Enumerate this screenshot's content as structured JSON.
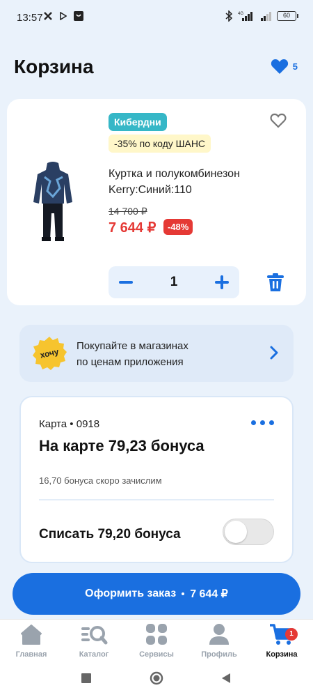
{
  "status_bar": {
    "time": "13:57",
    "battery": "60",
    "network": "4G"
  },
  "header": {
    "title": "Корзина",
    "favorites_count": "5"
  },
  "product": {
    "promo_tag": "Кибердни",
    "promo_code": "-35% по коду ШАНС",
    "name_line1": "Куртка и полукомбинезон",
    "name_line2": "Kerry:Синий:110",
    "old_price": "14 700 ₽",
    "new_price": "7 644 ₽",
    "discount": "-48%",
    "quantity": "1"
  },
  "store_banner": {
    "badge_text": "хочу",
    "line1": "Покупайте в магазинах",
    "line2": "по ценам приложения"
  },
  "bonus_card": {
    "card_label": "Карта • 0918",
    "balance": "На карте 79,23 бонуса",
    "pending": "16,70 бонуса скоро зачислим",
    "write_off": "Списать 79,20 бонуса",
    "write_off_enabled": false
  },
  "checkout": {
    "label": "Оформить заказ",
    "total": "7 644 ₽"
  },
  "bottom_nav": {
    "items": [
      {
        "label": "Главная",
        "icon": "home-icon"
      },
      {
        "label": "Каталог",
        "icon": "catalog-search-icon"
      },
      {
        "label": "Сервисы",
        "icon": "services-icon"
      },
      {
        "label": "Профиль",
        "icon": "profile-icon"
      },
      {
        "label": "Корзина",
        "icon": "cart-icon",
        "badge": "1",
        "active": true
      }
    ]
  },
  "colors": {
    "accent": "#1a6fe0",
    "sale": "#e53935",
    "promo": "#36b7c7",
    "background": "#eaf2fb"
  }
}
